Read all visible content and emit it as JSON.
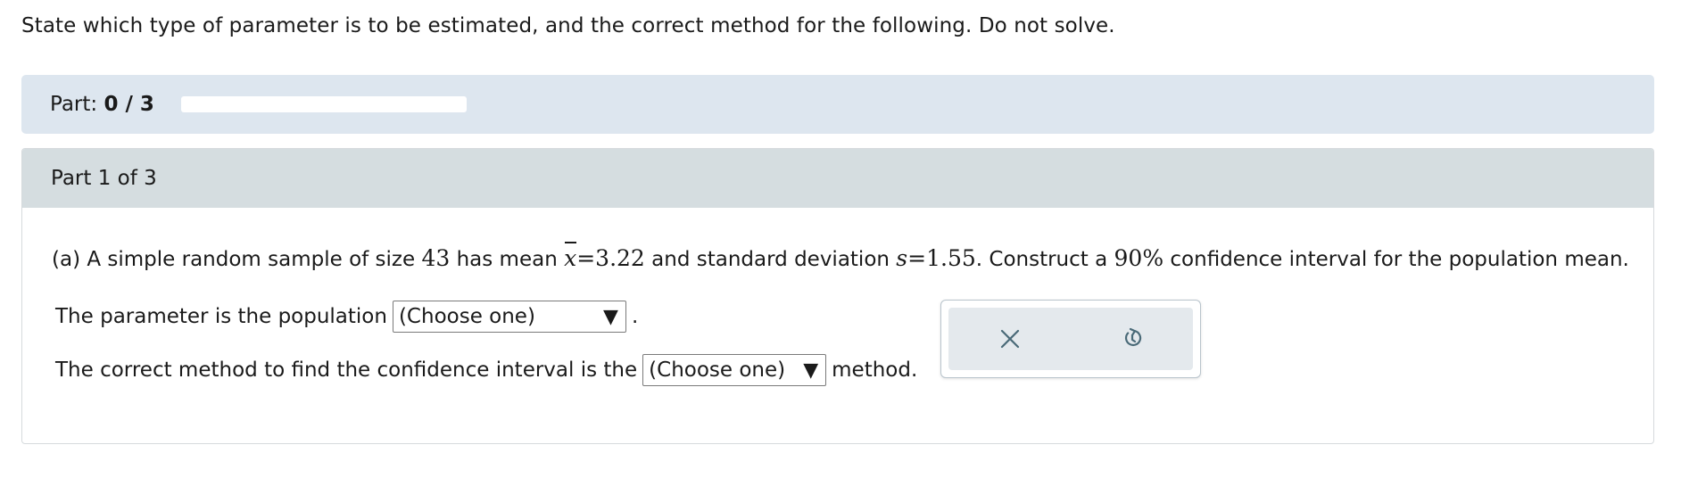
{
  "instructions": "State which type of parameter is to be estimated, and the correct method for the following. Do not solve.",
  "progress": {
    "label": "Part:",
    "value": "0 / 3",
    "fraction": 0
  },
  "part": {
    "header": "Part 1 of 3",
    "question": {
      "prefix": "(a) A simple random sample of size",
      "n": "43",
      "mean_text": "has mean",
      "xbar": "x",
      "eq": "=",
      "mean": "3.22",
      "sd_text": "and standard deviation",
      "s": "s",
      "sd": "1.55",
      "construct_text": ". Construct a",
      "conf": "90%",
      "suffix": "confidence interval for the population mean."
    },
    "row1": {
      "label": "The parameter is the population",
      "select": "(Choose one)",
      "end": "."
    },
    "row2": {
      "label": "The correct method to find the confidence interval is the",
      "select": "(Choose one)",
      "end": "method."
    }
  },
  "actions": {
    "clear_icon": "close-icon",
    "reset_icon": "undo-icon"
  },
  "colors": {
    "progress_bg": "#dde6ef",
    "part_header_bg": "#d5dde0",
    "action_bg": "#e4e9ed",
    "icon": "#4a6a78"
  }
}
